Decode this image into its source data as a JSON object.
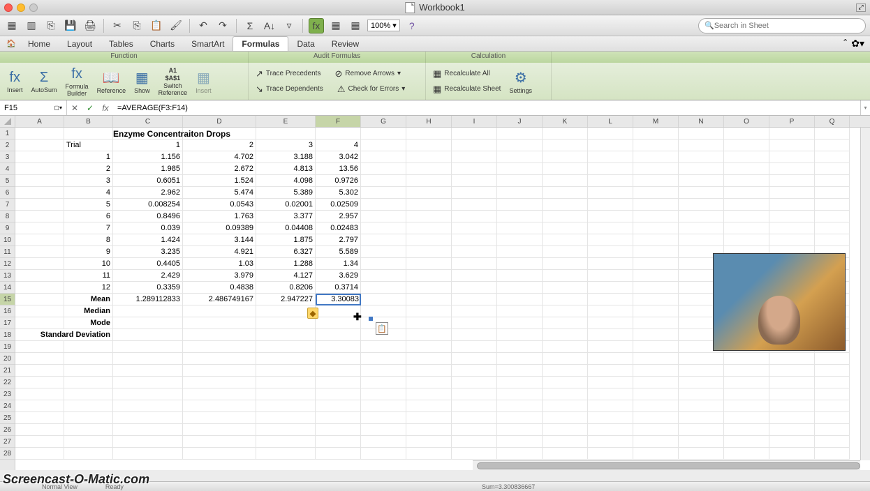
{
  "window": {
    "title": "Workbook1"
  },
  "qat": {
    "zoom": "100%",
    "search_placeholder": "Search in Sheet"
  },
  "tabs": [
    "Home",
    "Layout",
    "Tables",
    "Charts",
    "SmartArt",
    "Formulas",
    "Data",
    "Review"
  ],
  "tabs_active": 5,
  "sublabels": {
    "a": "Function",
    "b": "Audit Formulas",
    "c": "Calculation"
  },
  "ribbon": {
    "insert": "Insert",
    "autosum": "AutoSum",
    "fbuilder": "Formula\nBuilder",
    "reference": "Reference",
    "show": "Show",
    "switchref": "Switch\nReference",
    "a1": "A1",
    "a1abs": "$A$1",
    "insert2": "Insert",
    "traceprec": "Trace Precedents",
    "tracedep": "Trace Dependents",
    "removearr": "Remove Arrows",
    "checkerr": "Check for Errors",
    "recalcall": "Recalculate All",
    "recalcsheet": "Recalculate Sheet",
    "settings": "Settings"
  },
  "formula_bar": {
    "cell_ref": "F15",
    "formula": "=AVERAGE(F3:F14)"
  },
  "columns": [
    "A",
    "B",
    "C",
    "D",
    "E",
    "F",
    "G",
    "H",
    "I",
    "J",
    "K",
    "L",
    "M",
    "N",
    "O",
    "P",
    "Q"
  ],
  "sheet": {
    "title": "Enzyme Concentraiton Drops",
    "trial_label": "Trial",
    "headers": [
      "1",
      "2",
      "3",
      "4"
    ],
    "trials": [
      "1",
      "2",
      "3",
      "4",
      "5",
      "6",
      "7",
      "8",
      "9",
      "10",
      "11",
      "12"
    ],
    "data": [
      [
        "1.156",
        "4.702",
        "3.188",
        "3.042"
      ],
      [
        "1.985",
        "2.672",
        "4.813",
        "13.56"
      ],
      [
        "0.6051",
        "1.524",
        "4.098",
        "0.9726"
      ],
      [
        "2.962",
        "5.474",
        "5.389",
        "5.302"
      ],
      [
        "0.008254",
        "0.0543",
        "0.02001",
        "0.02509"
      ],
      [
        "0.8496",
        "1.763",
        "3.377",
        "2.957"
      ],
      [
        "0.039",
        "0.09389",
        "0.04408",
        "0.02483"
      ],
      [
        "1.424",
        "3.144",
        "1.875",
        "2.797"
      ],
      [
        "3.235",
        "4.921",
        "6.327",
        "5.589"
      ],
      [
        "0.4405",
        "1.03",
        "1.288",
        "1.34"
      ],
      [
        "2.429",
        "3.979",
        "4.127",
        "3.629"
      ],
      [
        "0.3359",
        "0.4838",
        "0.8206",
        "0.3714"
      ]
    ],
    "stats_labels": {
      "mean": "Mean",
      "median": "Median",
      "mode": "Mode",
      "stddev": "Standard Deviation"
    },
    "means": [
      "1.289112833",
      "2.486749167",
      "2.947224",
      "3.30083"
    ],
    "displayed_E15": "2.94722",
    "displayed_E15_suffix": "7"
  },
  "statusbar": {
    "view": "Normal View",
    "ready": "Ready",
    "sum": "Sum=3.300836667"
  },
  "watermark": "Screencast-O-Matic.com"
}
